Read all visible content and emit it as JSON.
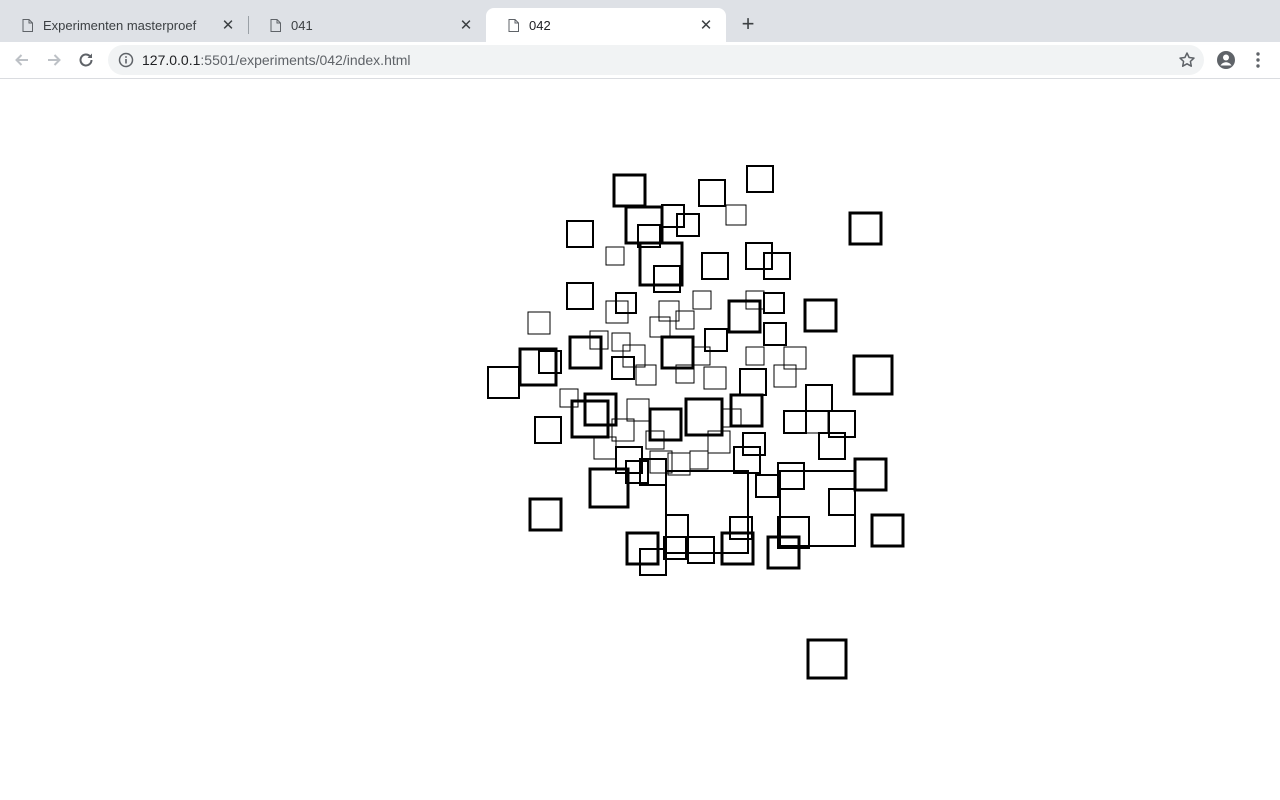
{
  "browser": {
    "tabs": [
      {
        "title": "Experimenten masterproef",
        "active": false
      },
      {
        "title": "041",
        "active": false
      },
      {
        "title": "042",
        "active": true
      }
    ],
    "url": {
      "host": "127.0.0.1",
      "rest": ":5501/experiments/042/index.html"
    }
  },
  "icons": {
    "back": "arrow-left-icon",
    "forward": "arrow-right-icon",
    "reload": "reload-icon",
    "info": "info-icon",
    "bookmark": "star-icon",
    "profile": "account-icon",
    "menu": "kebab-menu-icon",
    "tab_favicon": "document-icon",
    "tab_close": "close-icon",
    "new_tab": "plus-icon"
  }
}
